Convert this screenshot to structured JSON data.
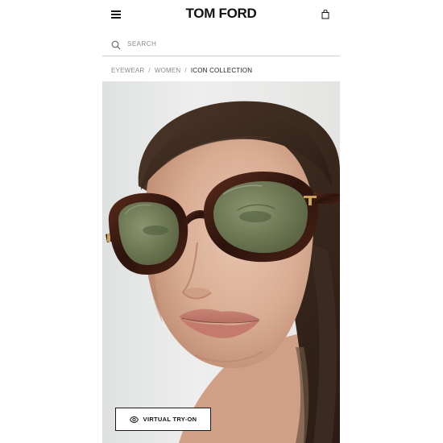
{
  "header": {
    "logo_text": "TOM FORD",
    "menu_icon": "hamburger-menu-icon",
    "bag_icon": "shopping-bag-icon"
  },
  "search": {
    "placeholder": "SEARCH",
    "value": "",
    "icon": "search-icon"
  },
  "breadcrumb": {
    "items": [
      "EYEWEAR",
      "WOMEN",
      "ICON COLLECTION"
    ],
    "separator": "/"
  },
  "hero": {
    "image": "model-wearing-tortoiseshell-oval-sunglasses",
    "tryon_button": {
      "label": "VIRTUAL TRY-ON",
      "icon": "eye-icon"
    }
  },
  "colors": {
    "text_primary": "#111111",
    "text_muted": "#8a8a8a",
    "divider": "#cfcfcf",
    "tortoise": "#3a1a12",
    "lens": "#6d7a55",
    "gold": "#c9a35a"
  }
}
